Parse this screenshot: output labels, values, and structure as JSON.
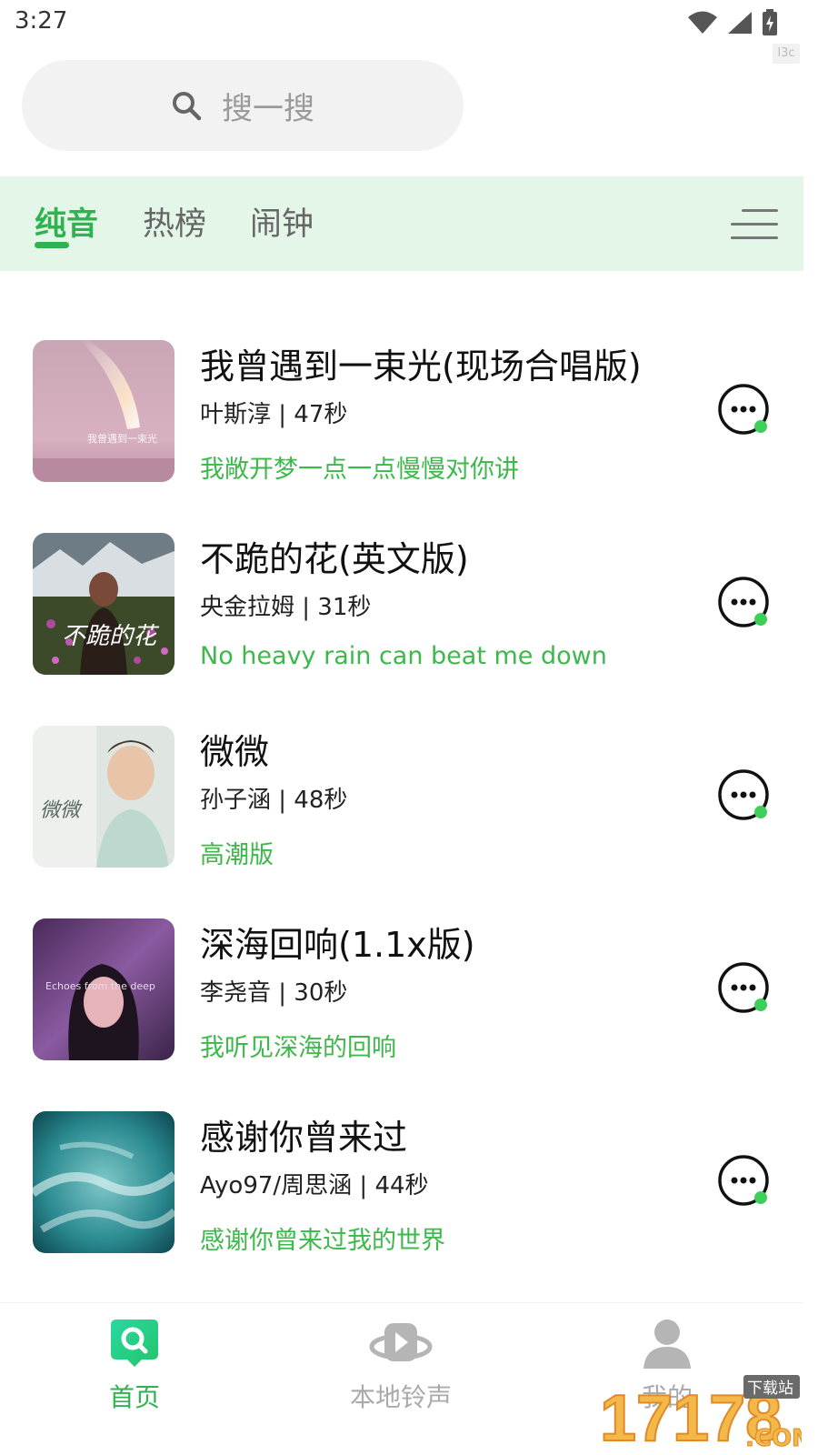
{
  "status": {
    "time": "3:27",
    "chip": "l3c"
  },
  "search": {
    "placeholder": "搜一搜"
  },
  "tabs": [
    {
      "label": "纯音",
      "active": true
    },
    {
      "label": "热榜",
      "active": false
    },
    {
      "label": "闹钟",
      "active": false
    }
  ],
  "songs": [
    {
      "title": "我曾遇到一束光(现场合唱版)",
      "meta": "叶斯淳 | 47秒",
      "sub": "我敞开梦一点一点慢慢对你讲",
      "cover_text": "我曾遇到一束光"
    },
    {
      "title": "不跪的花(英文版)",
      "meta": "央金拉姆 | 31秒",
      "sub": "No heavy rain can beat me down",
      "cover_text": "不跪的花"
    },
    {
      "title": "微微",
      "meta": "孙子涵 | 48秒",
      "sub": "高潮版",
      "cover_text": "微微"
    },
    {
      "title": "深海回响(1.1x版)",
      "meta": "李尧音 | 30秒",
      "sub": "我听见深海的回响",
      "cover_text": "Echoes from the deep"
    },
    {
      "title": "感谢你曾来过",
      "meta": "Ayo97/周思涵 | 44秒",
      "sub": "感谢你曾来过我的世界",
      "cover_text": ""
    }
  ],
  "nav": [
    {
      "label": "首页",
      "icon": "search-home-icon",
      "active": true
    },
    {
      "label": "本地铃声",
      "icon": "play-disc-icon",
      "active": false
    },
    {
      "label": "我的",
      "icon": "person-icon",
      "active": false
    }
  ],
  "watermark": {
    "text": "17178",
    "domain": ".COM",
    "badge": "下载站"
  },
  "colors": {
    "accent": "#2fb350",
    "subtitle": "#3db84b",
    "tab_bg": "#e3f6e7"
  }
}
